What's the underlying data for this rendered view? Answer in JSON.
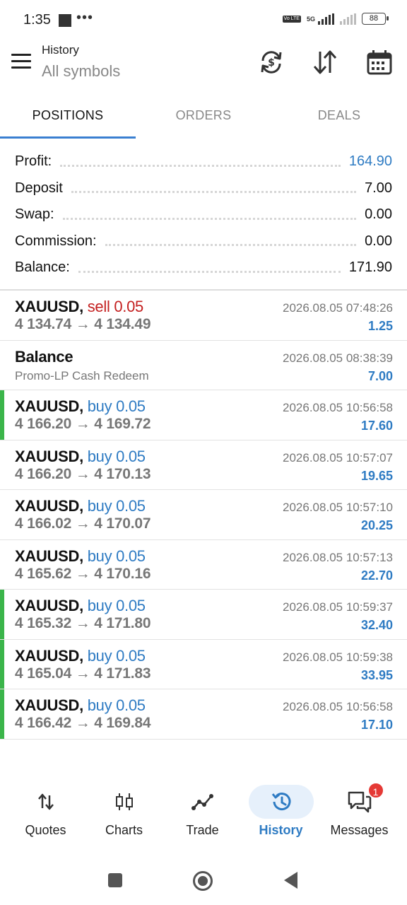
{
  "status_bar": {
    "time": "1:35",
    "dots": "•••",
    "volte": "Vo LTE",
    "network": "5G",
    "battery": "88"
  },
  "header": {
    "title": "History",
    "subtitle": "All symbols",
    "icons": [
      "sync-icon",
      "sort-icon",
      "calendar-icon"
    ]
  },
  "tabs": [
    {
      "label": "POSITIONS",
      "active": true
    },
    {
      "label": "ORDERS",
      "active": false
    },
    {
      "label": "DEALS",
      "active": false
    }
  ],
  "summary": [
    {
      "label": "Profit:",
      "value": "164.90",
      "highlight": true
    },
    {
      "label": "Deposit",
      "value": "7.00",
      "highlight": false
    },
    {
      "label": "Swap:",
      "value": "0.00",
      "highlight": false
    },
    {
      "label": "Commission:",
      "value": "0.00",
      "highlight": false
    },
    {
      "label": "Balance:",
      "value": "171.90",
      "highlight": false
    }
  ],
  "rows": [
    {
      "type": "trade",
      "symbol": "XAUUSD,",
      "side": "sell",
      "volume": "sell 0.05",
      "prices": "4 134.74 → 4 134.49",
      "time": "2026.08.05 07:48:26",
      "profit": "1.25",
      "bar": false
    },
    {
      "type": "balance",
      "title": "Balance",
      "comment": "Promo-LP Cash Redeem",
      "time": "2026.08.05 08:38:39",
      "profit": "7.00",
      "bar": false
    },
    {
      "type": "trade",
      "symbol": "XAUUSD,",
      "side": "buy",
      "volume": "buy 0.05",
      "prices": "4 166.20 → 4 169.72",
      "time": "2026.08.05 10:56:58",
      "profit": "17.60",
      "bar": true
    },
    {
      "type": "trade",
      "symbol": "XAUUSD,",
      "side": "buy",
      "volume": "buy 0.05",
      "prices": "4 166.20 → 4 170.13",
      "time": "2026.08.05 10:57:07",
      "profit": "19.65",
      "bar": false
    },
    {
      "type": "trade",
      "symbol": "XAUUSD,",
      "side": "buy",
      "volume": "buy 0.05",
      "prices": "4 166.02 → 4 170.07",
      "time": "2026.08.05 10:57:10",
      "profit": "20.25",
      "bar": false
    },
    {
      "type": "trade",
      "symbol": "XAUUSD,",
      "side": "buy",
      "volume": "buy 0.05",
      "prices": "4 165.62 → 4 170.16",
      "time": "2026.08.05 10:57:13",
      "profit": "22.70",
      "bar": false
    },
    {
      "type": "trade",
      "symbol": "XAUUSD,",
      "side": "buy",
      "volume": "buy 0.05",
      "prices": "4 165.32 → 4 171.80",
      "time": "2026.08.05 10:59:37",
      "profit": "32.40",
      "bar": true
    },
    {
      "type": "trade",
      "symbol": "XAUUSD,",
      "side": "buy",
      "volume": "buy 0.05",
      "prices": "4 165.04 → 4 171.83",
      "time": "2026.08.05 10:59:38",
      "profit": "33.95",
      "bar": true
    },
    {
      "type": "trade",
      "symbol": "XAUUSD,",
      "side": "buy",
      "volume": "buy 0.05",
      "prices": "4 166.42 → 4 169.84",
      "time": "2026.08.05 10:56:58",
      "profit": "17.10",
      "bar": true
    }
  ],
  "bottom_nav": [
    {
      "label": "Quotes",
      "icon": "quotes-icon",
      "active": false
    },
    {
      "label": "Charts",
      "icon": "charts-icon",
      "active": false
    },
    {
      "label": "Trade",
      "icon": "trade-icon",
      "active": false
    },
    {
      "label": "History",
      "icon": "history-icon",
      "active": true
    },
    {
      "label": "Messages",
      "icon": "messages-icon",
      "active": false,
      "badge": "1"
    }
  ],
  "colors": {
    "accent_blue": "#2e7bc3",
    "sell_red": "#c42020",
    "bar_green": "#3bb54a",
    "tab_underline": "#3a7fd1"
  }
}
